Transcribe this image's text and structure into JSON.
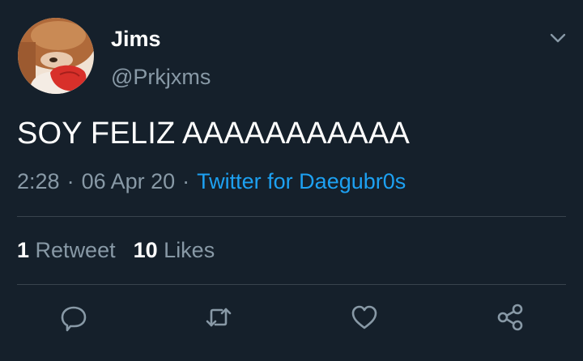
{
  "user": {
    "display_name": "Jims",
    "handle": "@Prkjxms"
  },
  "tweet": {
    "text": "SOY FELIZ AAAAAAAAAAA",
    "time": "2:28",
    "date": "06 Apr 20",
    "separator": "·",
    "source": "Twitter for Daegubr0s"
  },
  "stats": {
    "retweets_count": "1",
    "retweets_label": "Retweet",
    "likes_count": "10",
    "likes_label": "Likes"
  },
  "icons": {
    "caret": "chevron-down-icon",
    "reply": "reply-icon",
    "retweet": "retweet-icon",
    "like": "heart-icon",
    "share": "share-icon"
  },
  "colors": {
    "background": "#15202b",
    "primary_text": "#ffffff",
    "secondary_text": "#8899a6",
    "accent": "#1da1f2",
    "divider": "#38444d"
  }
}
